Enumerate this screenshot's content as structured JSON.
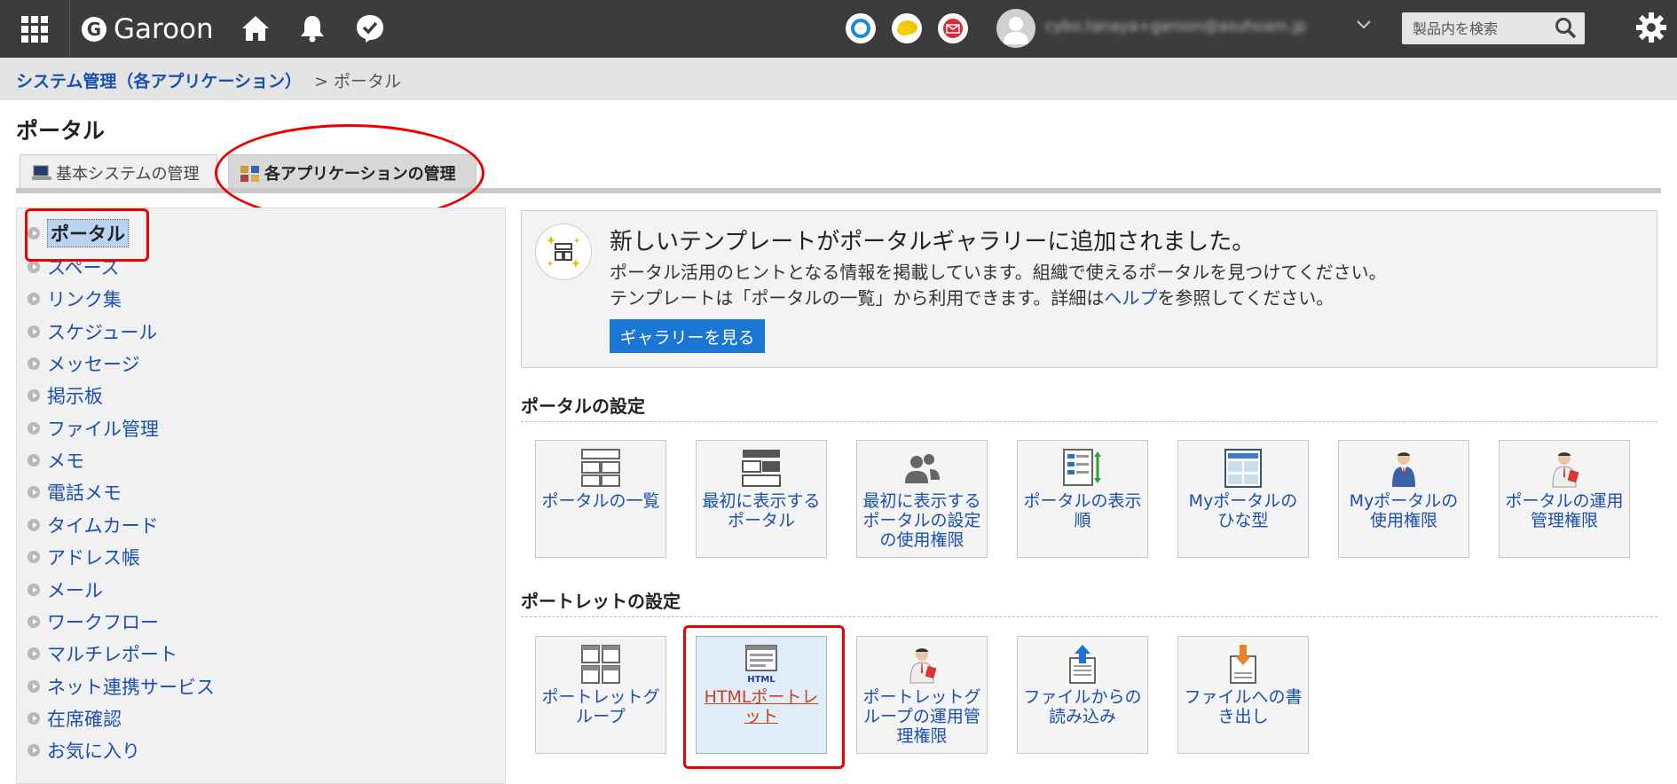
{
  "header": {
    "app_name": "Garoon",
    "app_logo_letter": "G",
    "search_placeholder": "製品内を検索",
    "username_blurred": "cybo.tanaya+garoon@asuhoam.jp"
  },
  "breadcrumb": {
    "parent": "システム管理（各アプリケーション）",
    "separator": ">",
    "current": "ポータル"
  },
  "page": {
    "title": "ポータル",
    "tabs": [
      {
        "label": "基本システムの管理",
        "active": false
      },
      {
        "label": "各アプリケーションの管理",
        "active": true
      }
    ]
  },
  "sidebar": {
    "items": [
      {
        "label": "ポータル",
        "selected": true
      },
      {
        "label": "スペース"
      },
      {
        "label": "リンク集"
      },
      {
        "label": "スケジュール"
      },
      {
        "label": "メッセージ"
      },
      {
        "label": "掲示板"
      },
      {
        "label": "ファイル管理"
      },
      {
        "label": "メモ"
      },
      {
        "label": "電話メモ"
      },
      {
        "label": "タイムカード"
      },
      {
        "label": "アドレス帳"
      },
      {
        "label": "メール"
      },
      {
        "label": "ワークフロー"
      },
      {
        "label": "マルチレポート"
      },
      {
        "label": "ネット連携サービス"
      },
      {
        "label": "在席確認"
      },
      {
        "label": "お気に入り"
      }
    ]
  },
  "notice": {
    "heading": "新しいテンプレートがポータルギャラリーに追加されました。",
    "line1": "ポータル活用のヒントとなる情報を掲載しています。組織で使えるポータルを見つけてください。",
    "line2_pre": "テンプレートは「ポータルの一覧」から利用できます。詳細は",
    "line2_link": "ヘルプ",
    "line2_post": "を参照してください。",
    "button": "ギャラリーを見る"
  },
  "portal_settings": {
    "title": "ポータルの設定",
    "cards": [
      {
        "label": "ポータルの一覧",
        "icon": "portal-list-icon"
      },
      {
        "label": "最初に表示するポータル",
        "icon": "initial-portal-icon"
      },
      {
        "label": "最初に表示するポータルの設定の使用権限",
        "icon": "users-permission-icon"
      },
      {
        "label": "ポータルの表示順",
        "icon": "display-order-icon"
      },
      {
        "label": "Myポータルのひな型",
        "icon": "template-icon"
      },
      {
        "label": "Myポータルの使用権限",
        "icon": "user-person-icon"
      },
      {
        "label": "ポータルの運用管理権限",
        "icon": "admin-person-icon"
      }
    ]
  },
  "portlet_settings": {
    "title": "ポートレットの設定",
    "cards": [
      {
        "label": "ポートレットグループ",
        "icon": "portlet-group-icon"
      },
      {
        "label": "HTMLポートレット",
        "icon": "html-portlet-icon",
        "highlighted": true
      },
      {
        "label": "ポートレットグループの運用管理権限",
        "icon": "admin-person-icon"
      },
      {
        "label": "ファイルからの読み込み",
        "icon": "file-import-icon"
      },
      {
        "label": "ファイルへの書き出し",
        "icon": "file-export-icon"
      }
    ]
  }
}
